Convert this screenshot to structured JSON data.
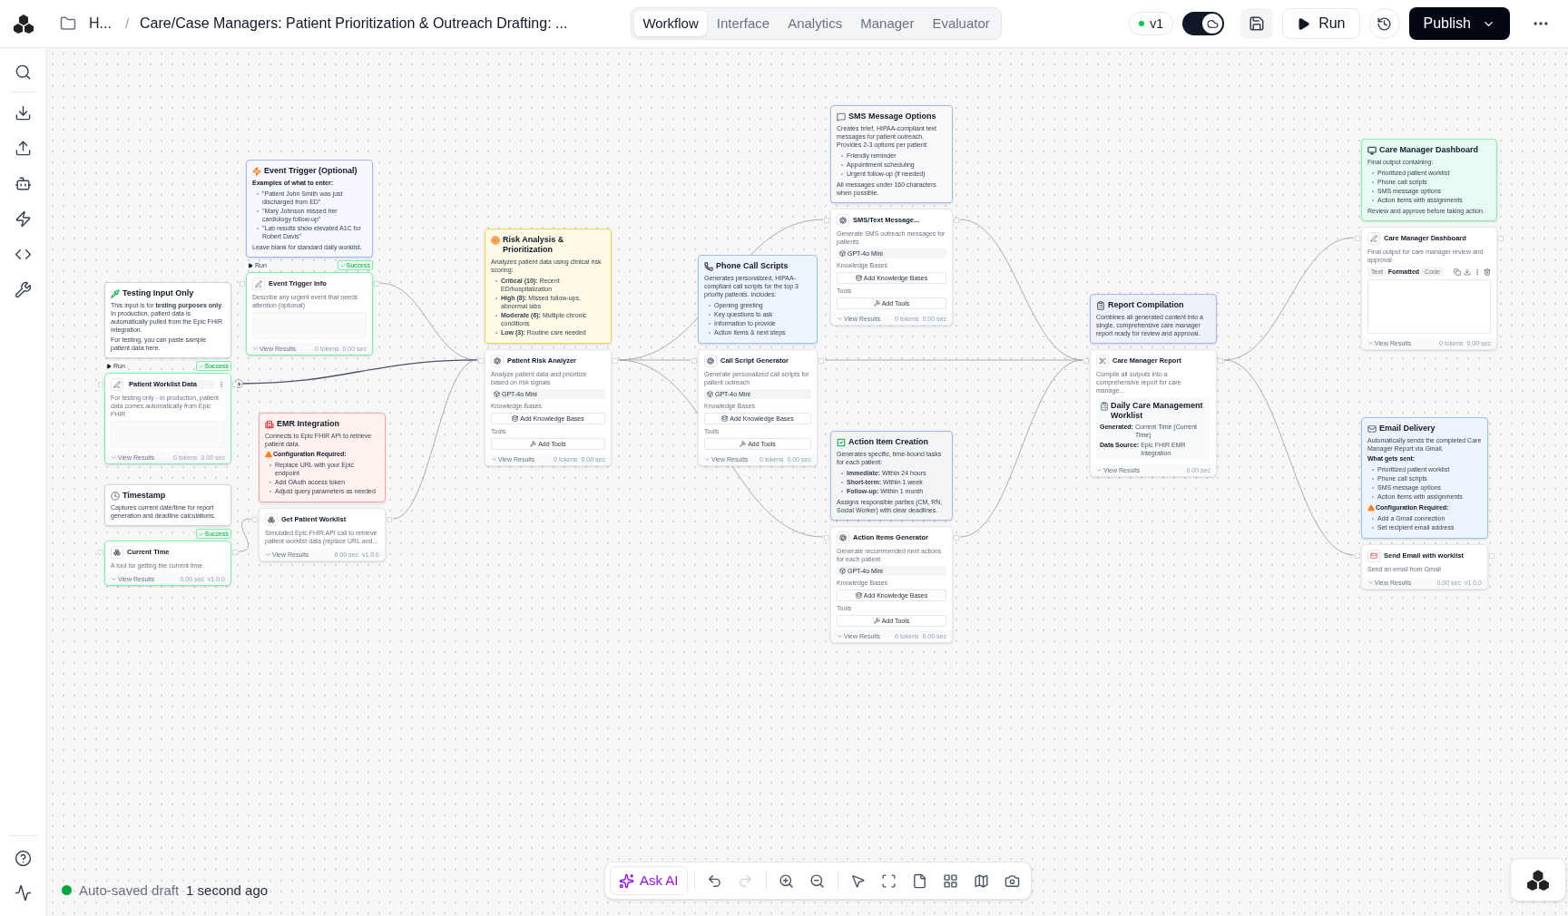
{
  "header": {
    "breadcrumb_root": "H...",
    "separator": "/",
    "title": "Care/Case Managers: Patient Prioritization & Outreach Drafting: ...",
    "tabs": [
      {
        "label": "Workflow",
        "selected": true
      },
      {
        "label": "Interface",
        "selected": false
      },
      {
        "label": "Analytics",
        "selected": false
      },
      {
        "label": "Manager",
        "selected": false
      },
      {
        "label": "Evaluator",
        "selected": false
      }
    ],
    "version": "v1",
    "cloud_sync_on": true,
    "run": "Run",
    "publish": "Publish"
  },
  "canvas": {
    "notes": [
      {
        "title": "Event Trigger (Optional)",
        "color": "#f7f8ff",
        "body": [
          {
            "kind": "heading",
            "text": "Examples of what to enter:"
          },
          {
            "kind": "bullets",
            "items": [
              "\"Patient John Smith was just discharged from ED\"",
              "\"Mary Johnson missed her cardiology follow-up\"",
              "\"Lab results show elevated A1C for Robert Davis\""
            ]
          },
          {
            "kind": "text",
            "text": "Leave blank for standard daily worklist."
          }
        ]
      },
      {
        "title": "Testing Input Only",
        "color": "#ffffff",
        "body": [
          {
            "kind": "text",
            "text": "This input is for **testing purposes only**. In production, patient data is automatically pulled from the Epic FHIR integration."
          },
          {
            "kind": "text",
            "text": "For testing, you can paste sample patient data here."
          }
        ]
      },
      {
        "title": "Timestamp",
        "color": "#ffffff",
        "body": [
          {
            "kind": "text",
            "text": "Captures current date/time for report generation and deadline calculations."
          }
        ]
      },
      {
        "title": "EMR Integration",
        "color": "#fff1ee",
        "body": [
          {
            "kind": "text",
            "text": "Connects to Epic FHIR API to retrieve patient data."
          },
          {
            "kind": "warning",
            "text": "Configuration Required:"
          },
          {
            "kind": "bullets",
            "items": [
              "Replace URL with your Epic endpoint",
              "Add OAuth access token",
              "Adjust query parameters as needed"
            ]
          }
        ]
      },
      {
        "title": "Risk Analysis & Prioritization",
        "color": "#fffbe6",
        "body": [
          {
            "kind": "text",
            "text": "Analyzes patient data using clinical risk scoring:"
          },
          {
            "kind": "bullets",
            "items": [
              "**Critical (10):** Recent ED/hospitalization",
              "**High (8):** Missed follow-ups, abnormal labs",
              "**Moderate (6):** Multiple chronic conditions",
              "**Low (3):** Routine care needed"
            ]
          }
        ]
      },
      {
        "title": "Phone Call Scripts",
        "color": "#eef5ff",
        "body": [
          {
            "kind": "text",
            "text": "Generates personalized, HIPAA-compliant call scripts for the top 3 priority patients. Includes:"
          },
          {
            "kind": "bullets",
            "items": [
              "Opening greeting",
              "Key questions to ask",
              "Information to provide",
              "Action items & next steps"
            ]
          }
        ]
      },
      {
        "title": "SMS Message Options",
        "color": "#f9f9fb",
        "body": [
          {
            "kind": "text",
            "text": "Creates brief, HIPAA-compliant text messages for patient outreach. Provides 2-3 options per patient:"
          },
          {
            "kind": "bullets",
            "items": [
              "Friendly reminder",
              "Appointment scheduling",
              "Urgent follow-up (if needed)"
            ]
          },
          {
            "kind": "text",
            "text": "All messages under 160 characters when possible."
          }
        ]
      },
      {
        "title": "Action Item Creation",
        "color": "#f3f4f6",
        "body": [
          {
            "kind": "text",
            "text": "Generates specific, time-bound tasks for each patient:"
          },
          {
            "kind": "bullets",
            "items": [
              "**Immediate:** Within 24 hours",
              "**Short-term:** Within 1 week",
              "**Follow-up:** Within 1 month"
            ]
          },
          {
            "kind": "text",
            "text": "Assigns responsible parties (CM, RN, Social Worker) with clear deadlines."
          }
        ]
      },
      {
        "title": "Report Compilation",
        "color": "#eef1f9",
        "body": [
          {
            "kind": "text",
            "text": "Combines all generated content into a single, comprehensive care manager report ready for review and approval."
          }
        ]
      },
      {
        "title": "Care Manager Dashboard",
        "color": "#e6fbf1",
        "body": [
          {
            "kind": "text",
            "text": "Final output containing:"
          },
          {
            "kind": "bullets",
            "items": [
              "Prioritized patient worklist",
              "Phone call scripts",
              "SMS message options",
              "Action items with assignments"
            ]
          },
          {
            "kind": "text",
            "text": "Review and approve before taking action."
          }
        ]
      },
      {
        "title": "Email Delivery",
        "color": "#eef4ff",
        "body": [
          {
            "kind": "text",
            "text": "Automatically sends the completed Care Manager Report via Gmail."
          },
          {
            "kind": "heading",
            "text": "What gets sent:"
          },
          {
            "kind": "bullets",
            "items": [
              "Prioritized patient worklist",
              "Phone call scripts",
              "SMS message options",
              "Action items with assignments"
            ]
          },
          {
            "kind": "warning",
            "text": "Configuration Required:"
          },
          {
            "kind": "bullets",
            "items": [
              "Add a Gmail connection",
              "Set recipient email address"
            ]
          }
        ]
      }
    ],
    "blocks": [
      {
        "kind": "input",
        "title": "Event Trigger Info",
        "description": "Describe any urgent event that needs attention (optional)",
        "run_tag": "Run",
        "status": "Success",
        "footer": "View Results",
        "meta": [
          "0 tokens",
          "0.00 sec"
        ]
      },
      {
        "kind": "input",
        "title": "Patient Worklist Data",
        "description": "For testing only - in production, patient data comes automatically from Epic FHIR",
        "run_tag": "Run",
        "status": "Success",
        "footer": "View Results",
        "meta": [
          "0 tokens",
          "0.00 sec"
        ]
      },
      {
        "kind": "tool",
        "title": "Current Time",
        "description": "A tool for getting the current time.",
        "status": "Success",
        "footer": "View Results",
        "meta": [
          "0.00 sec",
          "v1.0.0"
        ]
      },
      {
        "kind": "tool",
        "title": "Get Patient Worklist",
        "description": "Simulated Epic FHIR API call to retrieve patient worklist data (replace URL and...",
        "footer": "View Results",
        "meta": [
          "0.00 sec",
          "v1.0.0"
        ]
      },
      {
        "kind": "agent",
        "title": "Patient Risk Analyzer",
        "description": "Analyze patient data and prioritize based on risk signals",
        "model": "GPT-4o Mini",
        "kb_label": "Knowledge Bases",
        "kb_button": "Add Knowledge Bases",
        "tools_label": "Tools",
        "tools_button": "Add Tools",
        "footer": "View Results",
        "meta": [
          "0 tokens",
          "0.00 sec"
        ]
      },
      {
        "kind": "agent",
        "title": "Call Script Generator",
        "description": "Generate personalized call scripts for patient outreach",
        "model": "GPT-4o Mini",
        "kb_label": "Knowledge Bases",
        "kb_button": "Add Knowledge Bases",
        "tools_label": "Tools",
        "tools_button": "Add Tools",
        "footer": "View Results",
        "meta": [
          "0 tokens",
          "0.00 sec"
        ]
      },
      {
        "kind": "agent",
        "title": "SMS/Text Message...",
        "description": "Generate SMS outreach messages for patients",
        "model": "GPT-4o Mini",
        "kb_label": "Knowledge Bases",
        "kb_button": "Add Knowledge Bases",
        "tools_label": "Tools",
        "tools_button": "Add Tools",
        "footer": "View Results",
        "meta": [
          "0 tokens",
          "0.00 sec"
        ]
      },
      {
        "kind": "agent",
        "title": "Action Items Generator",
        "description": "Generate recommended next actions for each patient",
        "model": "GPT-4o Mini",
        "kb_label": "Knowledge Bases",
        "kb_button": "Add Knowledge Bases",
        "tools_label": "Tools",
        "tools_button": "Add Tools",
        "footer": "View Results",
        "meta": [
          "0 tokens",
          "0.00 sec"
        ]
      },
      {
        "kind": "report",
        "title": "Care Manager Report",
        "description": "Compile all outputs into a comprehensive report for care manage...",
        "preview_title": "Daily Care Management Worklist",
        "preview_rows": [
          {
            "label": "Generated:",
            "value": "Current Time (Current Time)"
          },
          {
            "label": "Data Source:",
            "value": "Epic FHIR EMR Integration"
          }
        ],
        "footer": "View Results",
        "meta": [
          "0.00 sec"
        ]
      },
      {
        "kind": "output",
        "title": "Care Manager Dashboard",
        "description": "Final output for care manager review and approval",
        "view_tabs": [
          {
            "label": "Text",
            "selected": false
          },
          {
            "label": "Formatted",
            "selected": true
          },
          {
            "label": "Code",
            "selected": false
          }
        ],
        "footer": "View Results",
        "meta": [
          "0 tokens",
          "0.00 sec"
        ]
      },
      {
        "kind": "email",
        "title": "Send Email with worklist",
        "description": "Send an email from Gmail",
        "footer": "View Results",
        "meta": [
          "0.00 sec",
          "v1.0.0"
        ]
      }
    ]
  },
  "status": {
    "label": "Auto-saved draft",
    "time": "1 second ago"
  },
  "toolbar": {
    "ask_ai": "Ask AI"
  }
}
